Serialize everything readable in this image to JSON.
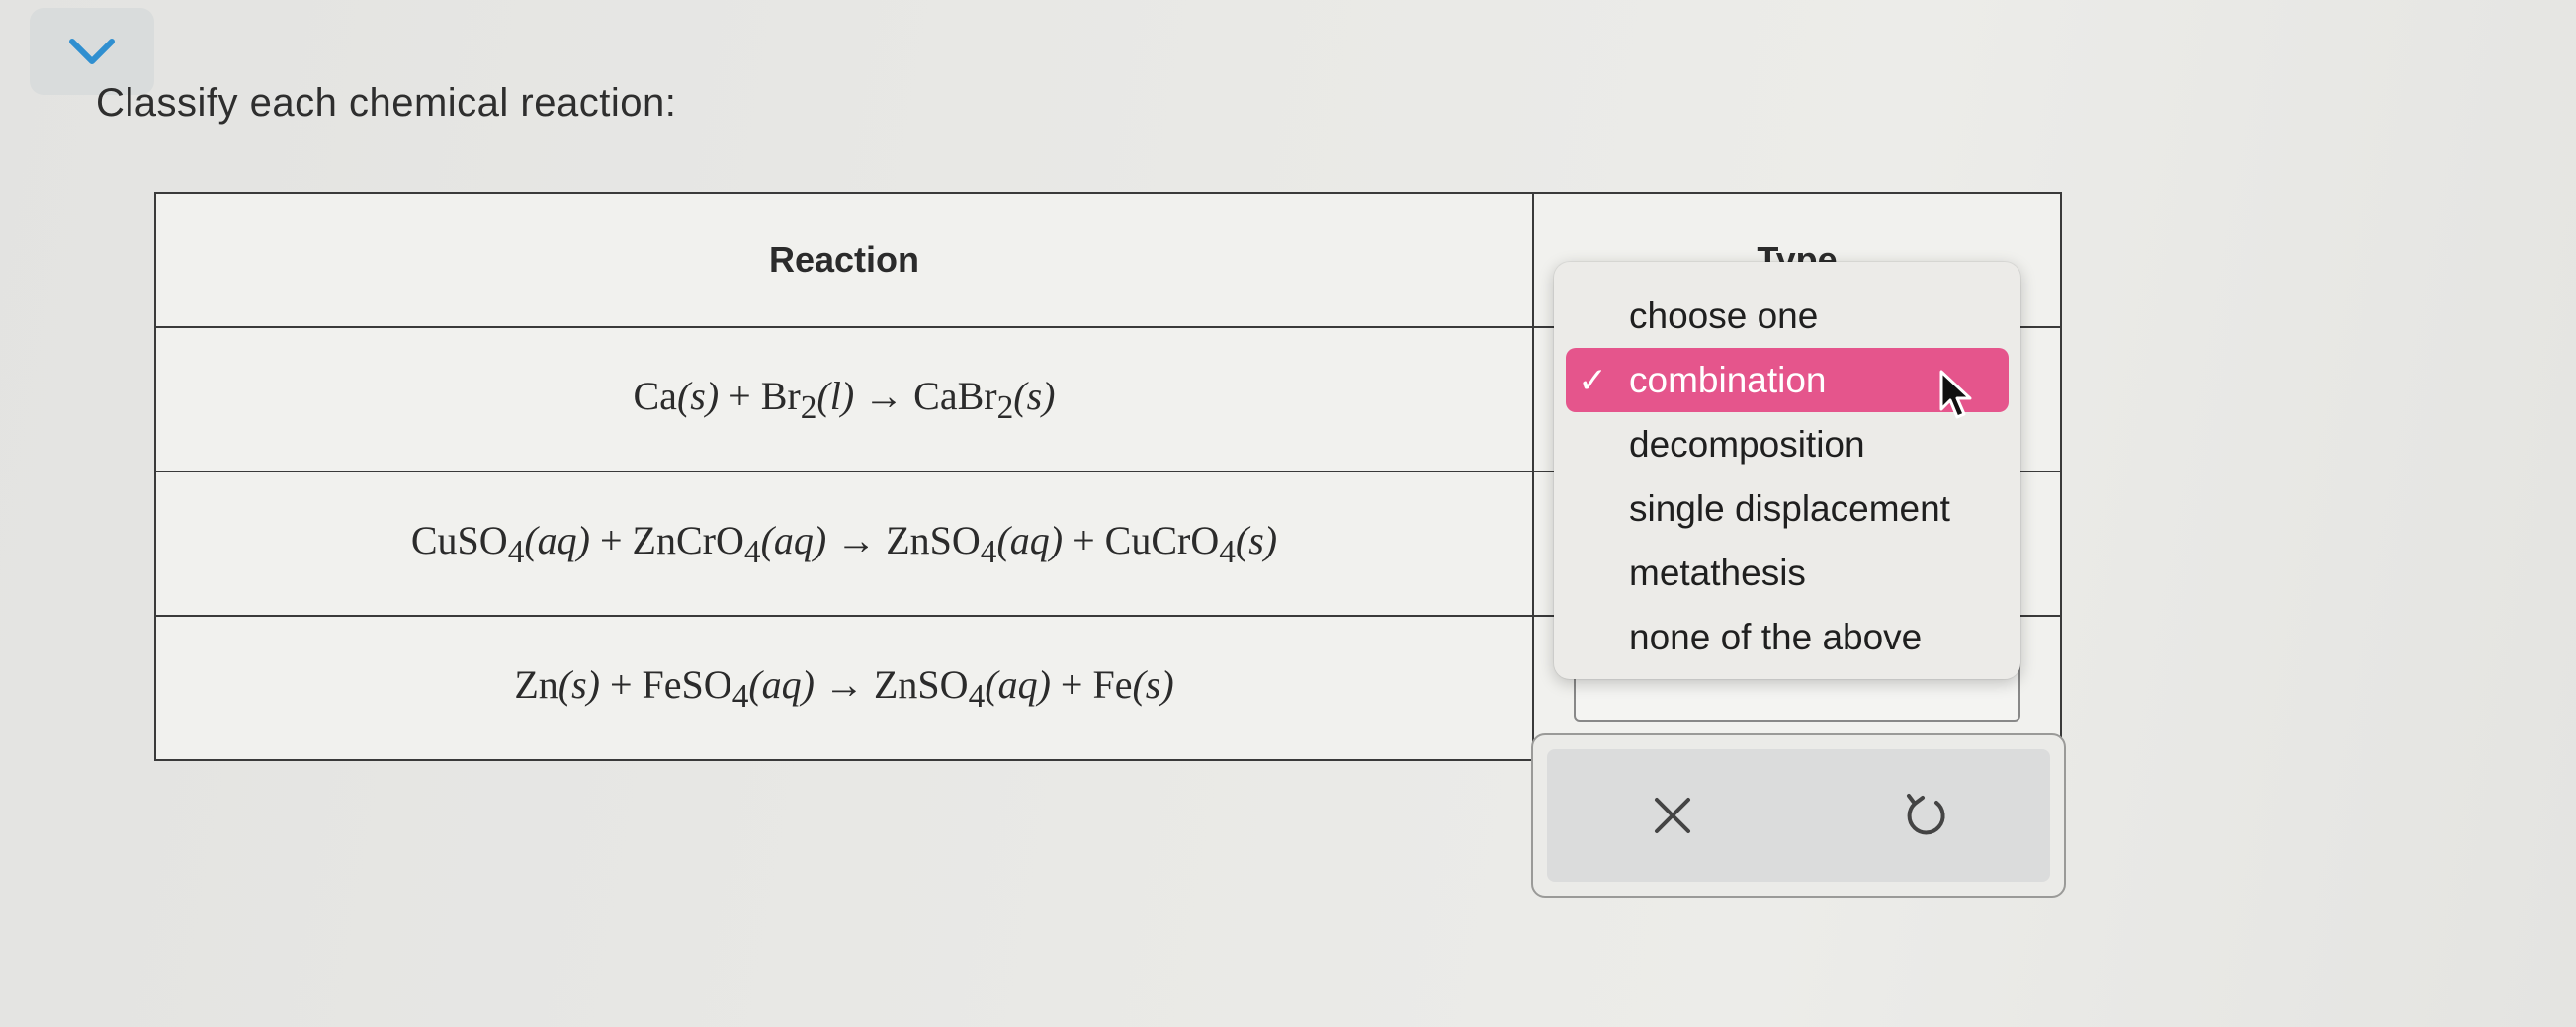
{
  "prompt": "Classify each chemical reaction:",
  "table": {
    "headers": {
      "reaction": "Reaction",
      "type": "Type"
    },
    "rows": [
      {
        "reaction": [
          {
            "t": "Ca"
          },
          {
            "t": "(s)",
            "i": true
          },
          {
            "t": " + Br"
          },
          {
            "t": "2",
            "sub": true
          },
          {
            "t": "(l)",
            "i": true
          },
          {
            "t": " → CaBr"
          },
          {
            "t": "2",
            "sub": true
          },
          {
            "t": "(s)",
            "i": true
          }
        ],
        "type": "combination"
      },
      {
        "reaction": [
          {
            "t": "CuSO"
          },
          {
            "t": "4",
            "sub": true
          },
          {
            "t": "(aq)",
            "i": true
          },
          {
            "t": " + ZnCrO"
          },
          {
            "t": "4",
            "sub": true
          },
          {
            "t": "(aq)",
            "i": true
          },
          {
            "t": " → ZnSO"
          },
          {
            "t": "4",
            "sub": true
          },
          {
            "t": "(aq)",
            "i": true
          },
          {
            "t": " + CuCrO"
          },
          {
            "t": "4",
            "sub": true
          },
          {
            "t": "(s)",
            "i": true
          }
        ],
        "type": ""
      },
      {
        "reaction": [
          {
            "t": "Zn"
          },
          {
            "t": "(s)",
            "i": true
          },
          {
            "t": " + FeSO"
          },
          {
            "t": "4",
            "sub": true
          },
          {
            "t": "(aq)",
            "i": true
          },
          {
            "t": " → ZnSO"
          },
          {
            "t": "4",
            "sub": true
          },
          {
            "t": "(aq)",
            "i": true
          },
          {
            "t": " + Fe"
          },
          {
            "t": "(s)",
            "i": true
          }
        ],
        "type": ""
      }
    ]
  },
  "dropdown": {
    "options": [
      "choose one",
      "combination",
      "decomposition",
      "single displacement",
      "metathesis",
      "none of the above"
    ],
    "selected_index": 1,
    "check": "✓",
    "highlight_color": "#e5558c"
  },
  "icons": {
    "collapse": "chevron-down-icon",
    "clear": "x-icon",
    "undo": "undo-icon"
  },
  "colors": {
    "accent": "#2f8fd0",
    "highlight": "#e5558c"
  }
}
